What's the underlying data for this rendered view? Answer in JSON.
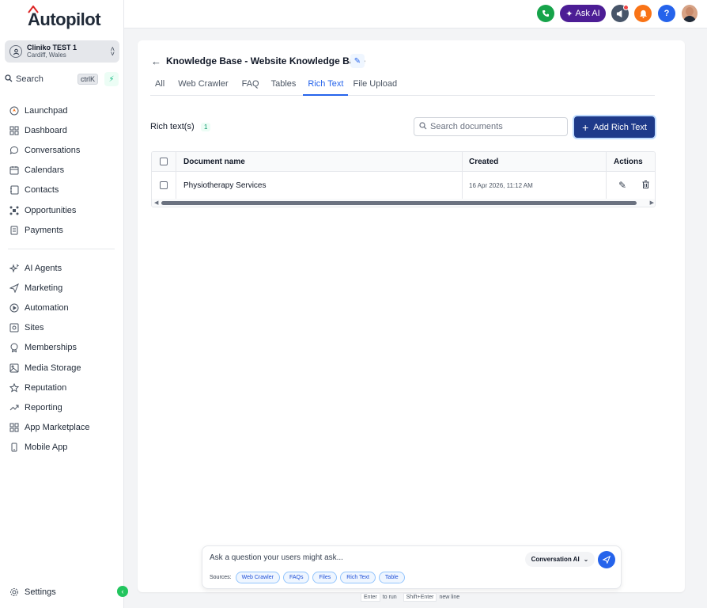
{
  "brand": {
    "logo_text": "Autopilot"
  },
  "account": {
    "name": "Cliniko TEST 1",
    "location": "Cardiff, Wales"
  },
  "search": {
    "label": "Search",
    "shortcut": "ctrlK"
  },
  "nav_primary": [
    {
      "label": "Launchpad",
      "icon": "rocket-icon"
    },
    {
      "label": "Dashboard",
      "icon": "grid-icon"
    },
    {
      "label": "Conversations",
      "icon": "chat-icon"
    },
    {
      "label": "Calendars",
      "icon": "calendar-icon"
    },
    {
      "label": "Contacts",
      "icon": "contacts-icon"
    },
    {
      "label": "Opportunities",
      "icon": "opportunities-icon"
    },
    {
      "label": "Payments",
      "icon": "payments-icon"
    }
  ],
  "nav_secondary": [
    {
      "label": "AI Agents",
      "icon": "sparkle-icon"
    },
    {
      "label": "Marketing",
      "icon": "send-icon"
    },
    {
      "label": "Automation",
      "icon": "automation-icon"
    },
    {
      "label": "Sites",
      "icon": "sites-icon"
    },
    {
      "label": "Memberships",
      "icon": "badge-icon"
    },
    {
      "label": "Media Storage",
      "icon": "image-icon"
    },
    {
      "label": "Reputation",
      "icon": "star-icon"
    },
    {
      "label": "Reporting",
      "icon": "trend-icon"
    },
    {
      "label": "App Marketplace",
      "icon": "apps-icon"
    },
    {
      "label": "Mobile App",
      "icon": "mobile-icon"
    }
  ],
  "settings": {
    "label": "Settings"
  },
  "topbar": {
    "ask_ai_label": "Ask AI",
    "help_label": "?"
  },
  "page": {
    "title": "Knowledge Base - Website Knowledge Base",
    "tabs": [
      "All",
      "Web Crawler",
      "FAQ",
      "Tables",
      "Rich Text",
      "File Upload"
    ],
    "active_tab": "Rich Text"
  },
  "rich_text": {
    "label": "Rich text(s)",
    "count": "1",
    "search_placeholder": "Search documents",
    "add_button": "Add Rich Text"
  },
  "table": {
    "columns": {
      "name": "Document name",
      "created": "Created",
      "actions": "Actions"
    },
    "rows": [
      {
        "name": "Physiotherapy Services",
        "created": "16 Apr 2026, 11:12 AM"
      }
    ]
  },
  "ask": {
    "placeholder": "Ask a question your users might ask...",
    "mode": "Conversation AI",
    "sources_label": "Sources:",
    "sources": [
      "Web Crawler",
      "FAQs",
      "Files",
      "Rich Text",
      "Table"
    ],
    "hint_enter_key": "Enter",
    "hint_enter_text": "to run",
    "hint_shift_key": "Shift+Enter",
    "hint_shift_text": "new line"
  },
  "colors": {
    "accent": "#2563eb",
    "primary_button": "#1e3a8a",
    "brand_dark": "#1f3a8a"
  }
}
